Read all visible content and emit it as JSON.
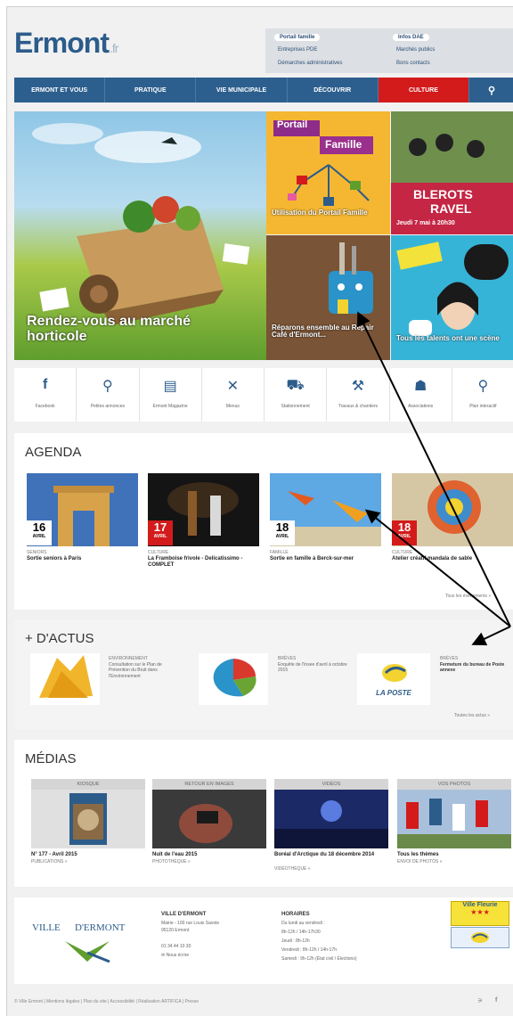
{
  "header": {
    "logo": "Ermont",
    "logo_suffix": ".fr",
    "quick_links": [
      "Portail famille",
      "Entreprises PDE",
      "Démarches administratives",
      "Infos DAE",
      "Marchés publics",
      "Bons contacts"
    ]
  },
  "nav": [
    "ERMONT ET VOUS",
    "PRATIQUE",
    "VIE MUNICIPALE",
    "DÉCOUVRIR",
    "CULTURE"
  ],
  "hero": {
    "main_caption": "Rendez-vous au marché horticole",
    "tile_portail_title_1": "Portail",
    "tile_portail_title_2": "Famille",
    "tile_portail_caption": "Utilisation du Portail Famille",
    "tile_blerots_title_1": "BLEROTS",
    "tile_blerots_title_2": "RAVEL",
    "tile_blerots_caption": "Jeudi 7 mai à 20h30",
    "tile_repair_caption": "Réparons ensemble au Repair Café d'Ermont...",
    "tile_talents_caption": "Tous les talents ont une scène"
  },
  "quick_access": [
    {
      "icon": "facebook-icon",
      "glyph": "f",
      "label": "Facebook"
    },
    {
      "icon": "chat-icon",
      "glyph": "⚲",
      "label": "Petites annonces"
    },
    {
      "icon": "magazine-icon",
      "glyph": "▤",
      "label": "Ermont Magazine"
    },
    {
      "icon": "cutlery-icon",
      "glyph": "✕",
      "label": "Menus"
    },
    {
      "icon": "car-icon",
      "glyph": "⛟",
      "label": "Stationnement"
    },
    {
      "icon": "works-icon",
      "glyph": "⚒",
      "label": "Travaux & chantiers"
    },
    {
      "icon": "associations-icon",
      "glyph": "☗",
      "label": "Associations"
    },
    {
      "icon": "map-pin-icon",
      "glyph": "⚲",
      "label": "Plan interactif"
    }
  ],
  "agenda": {
    "title": "AGENDA",
    "more": "Tous les évènements »",
    "items": [
      {
        "day": "16",
        "month": "AVRIL",
        "category": "SENIORS",
        "title": "Sortie seniors à Paris"
      },
      {
        "day": "17",
        "month": "AVRIL",
        "category": "CULTURE",
        "title": "La Framboise frivole - Delicatissimo - COMPLET"
      },
      {
        "day": "18",
        "month": "AVRIL",
        "category": "FAMILLE",
        "title": "Sortie en famille à Berck-sur-mer"
      },
      {
        "day": "18",
        "month": "AVRIL",
        "category": "CULTURE",
        "title": "Atelier créatif mandala de sable"
      }
    ]
  },
  "actus": {
    "title": "+ D'ACTUS",
    "more": "Toutes les actus »",
    "items": [
      {
        "category": "ENVIRONNEMENT",
        "title": "Consultation sur le Plan de Prévention du Bruit dans l'Environnement"
      },
      {
        "category": "BRÈVES",
        "title": "Enquête de l'Insee d'avril à octobre 2015"
      },
      {
        "category": "BRÈVES",
        "title": "Fermeture du bureau de Poste annexe",
        "logo": "LA POSTE"
      }
    ]
  },
  "medias": {
    "title": "MÉDIAS",
    "items": [
      {
        "header": "KIOSQUE",
        "title": "N° 177 - Avril 2015",
        "sub": "PUBLICATIONS »"
      },
      {
        "header": "RETOUR EN IMAGES",
        "title": "Nuit de l'eau 2015",
        "sub": "PHOTOTHÈQUE »"
      },
      {
        "header": "VIDÉOS",
        "title": "Boréal d'Arctique du 18 décembre 2014",
        "sub": "VIDÉOTHÈQUE »"
      },
      {
        "header": "VOS PHOTOS",
        "title": "Tous les thèmes",
        "sub": "ENVOI DE PHOTOS »"
      }
    ]
  },
  "footer": {
    "logo_1": "VILLE",
    "logo_2": "D'ERMONT",
    "address_title": "VILLE D'ERMONT",
    "address": [
      "Mairie - 100 rue Louis Savoie",
      "95120 Ermont"
    ],
    "phone": "01 34 44 10 30",
    "email": "Nous écrire",
    "hours_title": "HORAIRES",
    "hours": [
      "Du lundi au vendredi :",
      "8h-12h / 14h-17h30",
      "Jeudi : 8h-12h",
      "Vendredi : 8h-12h / 14h-17h",
      "Samedi : 9h-12h (État civil / Élections)"
    ],
    "badge_title": "Ville Fleurie",
    "badge_stars": "★★★",
    "bottom": "© Ville Ermont | Mentions légales | Plan du site | Accessibilité | Réalisation ARTIFICA | Presse"
  },
  "colors": {
    "brand_blue": "#2d5f8e",
    "culture_red": "#d31b1b"
  }
}
